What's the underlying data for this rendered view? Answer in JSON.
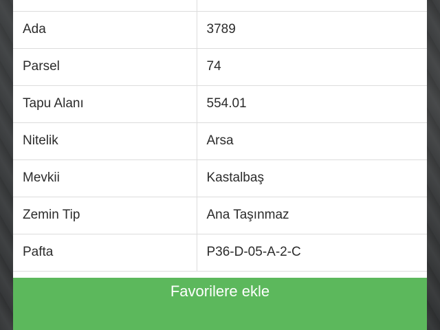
{
  "rows": [
    {
      "label": "",
      "value": ""
    },
    {
      "label": "Ada",
      "value": "3789"
    },
    {
      "label": "Parsel",
      "value": "74"
    },
    {
      "label": "Tapu Alanı",
      "value": "554.01"
    },
    {
      "label": "Nitelik",
      "value": "Arsa"
    },
    {
      "label": "Mevkii",
      "value": "Kastalbaş"
    },
    {
      "label": "Zemin Tip",
      "value": "Ana Taşınmaz"
    },
    {
      "label": "Pafta",
      "value": "P36-D-05-A-2-C"
    }
  ],
  "actions": {
    "favorite_label": "Favorilere ekle"
  },
  "colors": {
    "button_green": "#5cb85c",
    "divider": "#dcdcdc"
  }
}
